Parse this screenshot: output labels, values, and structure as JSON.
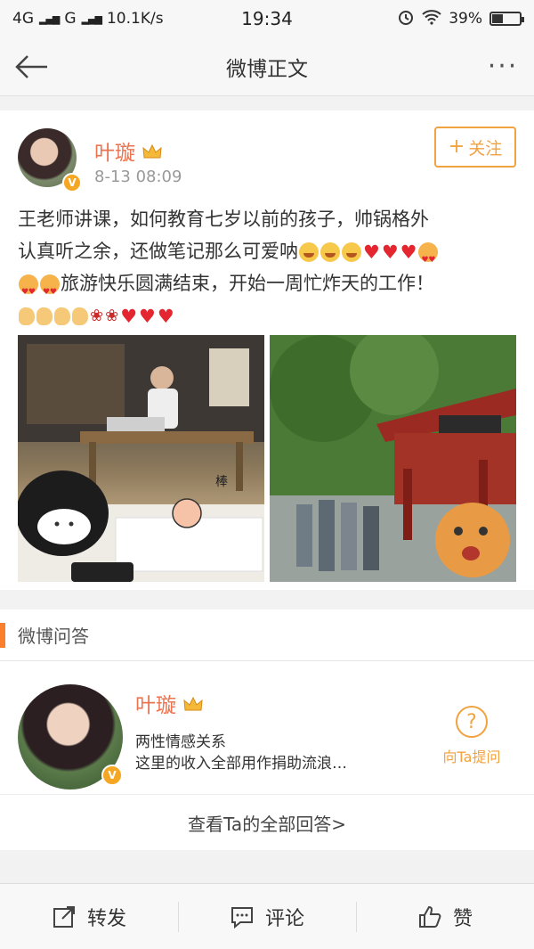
{
  "status_bar": {
    "network_1": "4G",
    "network_2": "G",
    "speed": "10.1K/s",
    "time": "19:34",
    "battery": "39%",
    "battery_level": 0.39
  },
  "nav": {
    "title": "微博正文",
    "more": "···"
  },
  "post": {
    "author": "叶璇",
    "time": "8-13 08:09",
    "follow_label": "关注",
    "text_line1": "王老师讲课，如何教育七岁以前的孩子，帅锅格外",
    "text_line2": "认真听之余，还做笔记那么可爱呐",
    "text_line3": "旅游快乐圆满结束，开始一周忙炸天的工作！",
    "sticker_text": "棒"
  },
  "qa": {
    "section_title": "微博问答",
    "author": "叶璇",
    "topic": "两性情感关系",
    "description": "这里的收入全部用作捐助流浪…",
    "ask_label": "向Ta提问",
    "view_all": "查看Ta的全部回答>"
  },
  "actions": {
    "repost": "转发",
    "comment": "评论",
    "like": "赞"
  },
  "colors": {
    "accent": "#f1a241",
    "name": "#eb7350",
    "qa_bar": "#f97f2c"
  }
}
